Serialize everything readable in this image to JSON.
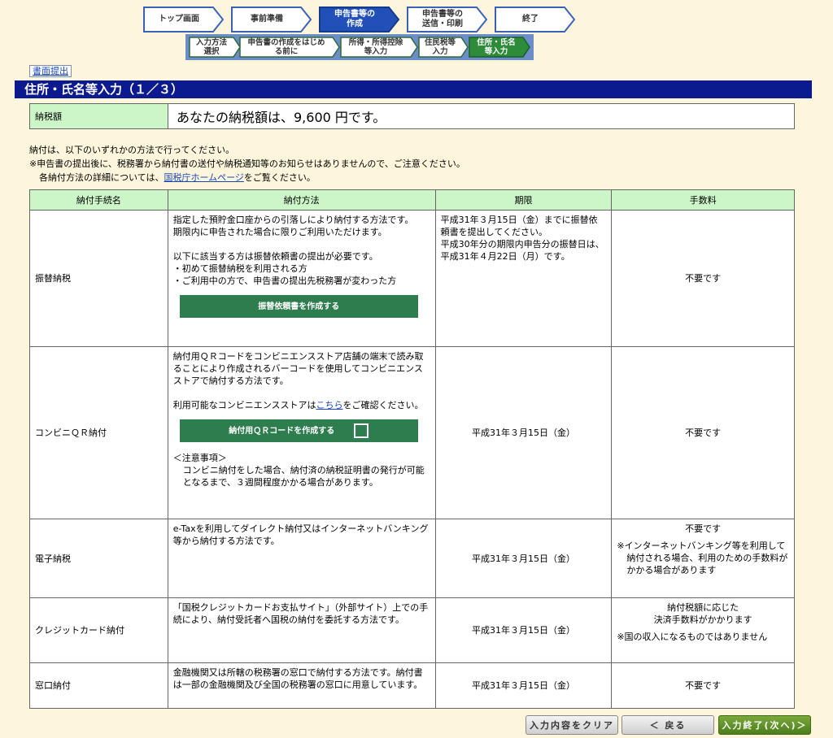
{
  "steps": [
    {
      "label": "トップ画面",
      "active": false
    },
    {
      "label": "事前準備",
      "active": false
    },
    {
      "label": "申告書等の\n作成",
      "active": true
    },
    {
      "label": "申告書等の\n送信・印刷",
      "active": false
    },
    {
      "label": "終了",
      "active": false
    }
  ],
  "substeps": [
    {
      "label": "入力方法\n選択",
      "active": false
    },
    {
      "label": "申告書の作成をはじめ\nる前に",
      "active": false
    },
    {
      "label": "所得・所得控除\n等入力",
      "active": false
    },
    {
      "label": "住民税等\n入力",
      "active": false
    },
    {
      "label": "住所・氏名\n等入力",
      "active": true
    }
  ],
  "print_button": "書面提出",
  "page_title": "住所・氏名等入力（１／３）",
  "tax": {
    "label": "納税額",
    "value": "あなたの納税額は、9,600 円です。"
  },
  "notes": {
    "line1": "納付は、以下のいずれかの方法で行ってください。",
    "line2": "※申告書の提出後に、税務署から納付書の送付や納税通知等のお知らせはありませんので、ご注意ください。",
    "line3_pre": "各納付方法の詳細については、",
    "line3_link": "国税庁ホームページ",
    "line3_post": "をご覧ください。"
  },
  "table": {
    "headers": [
      "納付手続名",
      "納付方法",
      "期限",
      "手数料"
    ],
    "direct_debit": {
      "name": "振替納税",
      "desc1": "指定した預貯金口座からの引落しにより納付する方法です。",
      "desc2": "期限内に申告された場合に限りご利用いただけます。",
      "desc3": "以下に該当する方は振替依頼書の提出が必要です。",
      "desc4": "・初めて振替納税を利用される方",
      "desc5": "・ご利用中の方で、申告書の提出先税務署が変わった方",
      "button": "振替依頼書を作成する",
      "deadline1": "平成31年３月15日（金）までに振替依頼書を提出してください。",
      "deadline2": "平成30年分の期限内申告分の振替日は、平成31年４月22日（月）です。",
      "fee": "不要です"
    },
    "convenience": {
      "name": "コンビニＱＲ納付",
      "desc1": "納付用ＱＲコードをコンビニエンスストア店舗の端末で読み取ることにより作成されるバーコードを使用してコンビニエンスストアで納付する方法です。",
      "desc2_pre": "利用可能なコンビニエンスストアは",
      "desc2_link": "こちら",
      "desc2_post": "をご確認ください。",
      "button": "納付用ＱＲコードを作成する",
      "caution_title": "＜注意事項＞",
      "caution_text": "コンビニ納付をした場合、納付済の納税証明書の発行が可能となるまで、３週間程度かかる場合があります。",
      "deadline": "平成31年３月15日（金）",
      "fee": "不要です"
    },
    "electronic": {
      "name": "電子納税",
      "desc": "e-Taxを利用してダイレクト納付又はインターネットバンキング等から納付する方法です。",
      "deadline": "平成31年３月15日（金）",
      "fee": "不要です",
      "fee_note": "※インターネットバンキング等を利用して納付される場合、利用のための手数料がかかる場合があります"
    },
    "credit": {
      "name": "クレジットカード納付",
      "desc": "「国税クレジットカードお支払サイト」（外部サイト）上での手続により、納付受託者へ国税の納付を委託する方法です。",
      "deadline": "平成31年３月15日（金）",
      "fee1": "納付税額に応じた",
      "fee2": "決済手数料がかかります",
      "fee_note": "※国の収入になるものではありません"
    },
    "counter": {
      "name": "窓口納付",
      "desc": "金融機関又は所轄の税務署の窓口で納付する方法です。納付書は一部の金融機関及び全国の税務署の窓口に用意しています。",
      "deadline": "平成31年３月15日（金）",
      "fee": "不要です"
    }
  },
  "buttons": {
    "clear": "入力内容をクリア",
    "back": "＜ 戻る",
    "next": "入力終了(次へ)＞"
  },
  "colors": {
    "active_step": "#2151b8",
    "active_substep": "#2e8b3a",
    "title_bar": "#0c1a90",
    "header_green": "#ccf5c8",
    "button_green": "#2e7d4f"
  }
}
